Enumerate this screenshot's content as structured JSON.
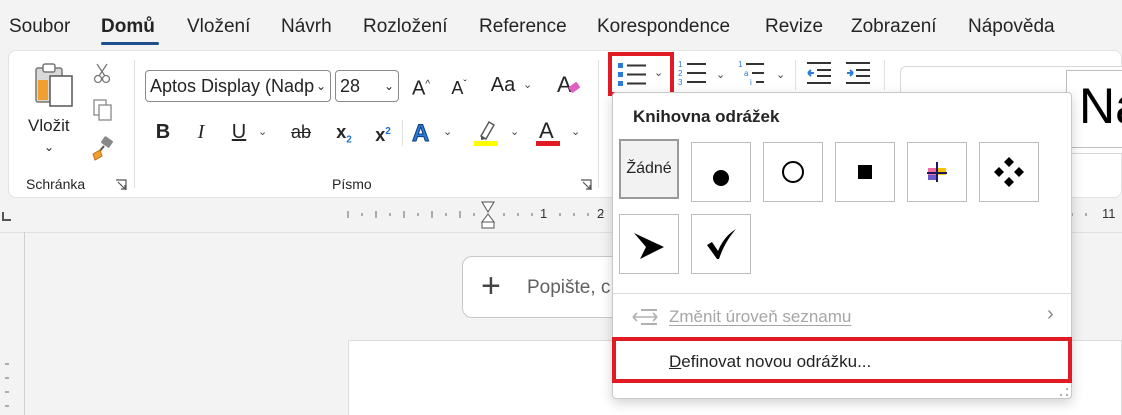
{
  "tabs": [
    {
      "label": "Soubor"
    },
    {
      "label": "Domů"
    },
    {
      "label": "Vložení"
    },
    {
      "label": "Návrh"
    },
    {
      "label": "Rozložení"
    },
    {
      "label": "Reference"
    },
    {
      "label": "Korespondence"
    },
    {
      "label": "Revize"
    },
    {
      "label": "Zobrazení"
    },
    {
      "label": "Nápověda"
    }
  ],
  "clipboard": {
    "paste_label": "Vložit",
    "group_label": "Schránka"
  },
  "font": {
    "family": "Aptos Display (Nadp",
    "size": "28",
    "group_label": "Písmo",
    "bold": "B",
    "italic": "I",
    "underline": "U",
    "strike": "ab",
    "subscript": "x",
    "subscript_mark": "2",
    "superscript": "x",
    "superscript_mark": "2",
    "change_case": "Aa",
    "text_effects": "A",
    "font_color": "A",
    "grow": "A",
    "shrink": "A",
    "highlight_color": "#ffff00",
    "font_color_bar": "#e01b24"
  },
  "styles_preview": "Na",
  "ruler": {
    "numbers": [
      "1",
      "2",
      "11"
    ]
  },
  "copilot": {
    "placeholder": "Popište, c"
  },
  "bullet_library": {
    "title": "Knihovna odrážek",
    "none_label": "Žádné",
    "change_level": "Změnit úroveň seznamu",
    "define_new": "Definovat novou odrážku..."
  },
  "colors": {
    "highlight_frame": "#e01b24",
    "accent_blue": "#1f4f8f"
  }
}
